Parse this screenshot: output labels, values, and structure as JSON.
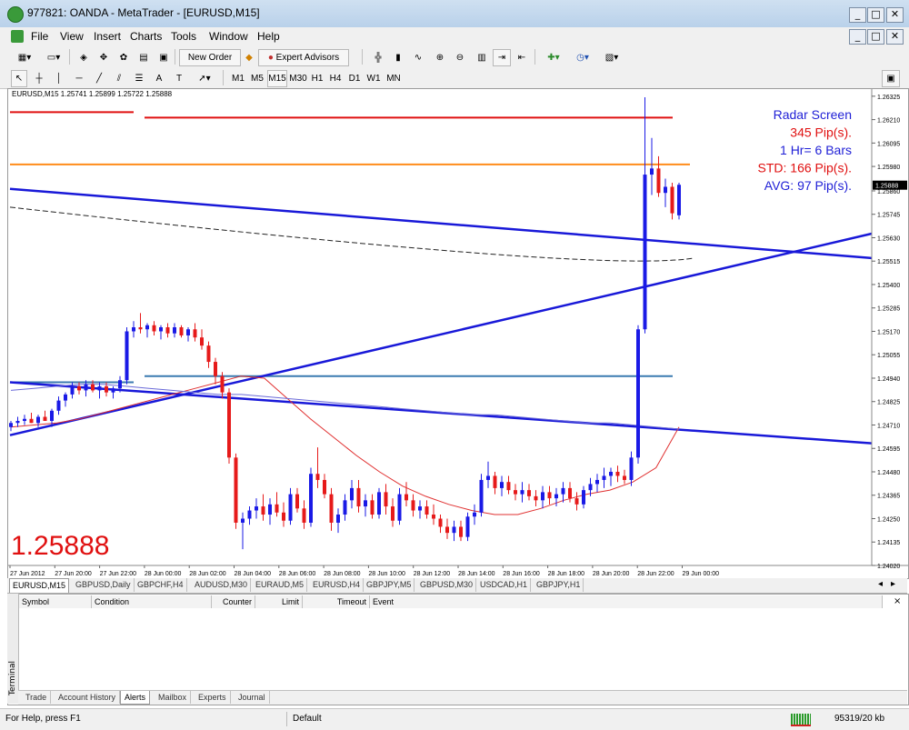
{
  "window": {
    "title": "977821: OANDA - MetaTrader - [EURUSD,M15]",
    "min_label": "_",
    "restore_label": "□",
    "close_label": "✕"
  },
  "menu": [
    "File",
    "View",
    "Insert",
    "Charts",
    "Tools",
    "Window",
    "Help"
  ],
  "toolbar": {
    "new_order": "New Order",
    "expert_advisors": "Expert Advisors"
  },
  "timeframes": [
    "M1",
    "M5",
    "M15",
    "M30",
    "H1",
    "H4",
    "D1",
    "W1",
    "MN"
  ],
  "active_timeframe": "M15",
  "chart": {
    "info": "EURUSD,M15  1.25741 1.25899 1.25722 1.25888",
    "big_price": "1.25888",
    "current_price_tag": "1.25888",
    "price_ticks": [
      "1.26325",
      "1.26210",
      "1.26095",
      "1.25980",
      "1.25860",
      "1.25745",
      "1.25630",
      "1.25515",
      "1.25400",
      "1.25285",
      "1.25170",
      "1.25055",
      "1.24940",
      "1.24825",
      "1.24710",
      "1.24595",
      "1.24480",
      "1.24365",
      "1.24250",
      "1.24135",
      "1.24020"
    ],
    "time_ticks": [
      "27 Jun 2012",
      "27 Jun 20:00",
      "27 Jun 22:00",
      "28 Jun 00:00",
      "28 Jun 02:00",
      "28 Jun 04:00",
      "28 Jun 06:00",
      "28 Jun 08:00",
      "28 Jun 10:00",
      "28 Jun 12:00",
      "28 Jun 14:00",
      "28 Jun 16:00",
      "28 Jun 18:00",
      "28 Jun 20:00",
      "28 Jun 22:00",
      "29 Jun 00:00"
    ],
    "radar": [
      {
        "text": "Radar Screen",
        "color": "#1f1fd6"
      },
      {
        "text": "345 Pip(s).",
        "color": "#e01010"
      },
      {
        "text": "1 Hr= 6 Bars",
        "color": "#1f1fd6"
      },
      {
        "text": "STD: 166 Pip(s).",
        "color": "#e01010"
      },
      {
        "text": "AVG: 97 Pip(s).",
        "color": "#1f1fd6"
      }
    ],
    "colors": {
      "bull": "#1a1ae6",
      "bear": "#e61a1a",
      "ma": "#e03030",
      "trend": "#1818d8",
      "resistance": "#e01010",
      "orange": "#ff8c1a"
    }
  },
  "chart_data": {
    "type": "candlestick",
    "symbol": "EURUSD",
    "timeframe": "M15",
    "ylim": [
      1.2402,
      1.2636
    ],
    "levels": {
      "red": 1.2622,
      "orange": 1.2599,
      "steel": 1.2495
    },
    "candles": [
      [
        1.247,
        1.2473,
        1.2468,
        1.2472
      ],
      [
        1.2472,
        1.2475,
        1.247,
        1.2473
      ],
      [
        1.2473,
        1.2476,
        1.2471,
        1.2474
      ],
      [
        1.2474,
        1.2477,
        1.2472,
        1.2472
      ],
      [
        1.2472,
        1.2476,
        1.247,
        1.2475
      ],
      [
        1.2475,
        1.2478,
        1.2473,
        1.2473
      ],
      [
        1.2473,
        1.2479,
        1.247,
        1.2478
      ],
      [
        1.2478,
        1.2485,
        1.2476,
        1.2483
      ],
      [
        1.2483,
        1.2487,
        1.248,
        1.2486
      ],
      [
        1.2486,
        1.2492,
        1.2484,
        1.249
      ],
      [
        1.249,
        1.2492,
        1.2486,
        1.2488
      ],
      [
        1.2488,
        1.2493,
        1.2485,
        1.2491
      ],
      [
        1.2491,
        1.2493,
        1.2487,
        1.2488
      ],
      [
        1.2488,
        1.2492,
        1.2484,
        1.249
      ],
      [
        1.249,
        1.2492,
        1.2485,
        1.2487
      ],
      [
        1.2487,
        1.249,
        1.2484,
        1.2489
      ],
      [
        1.2489,
        1.2495,
        1.2487,
        1.2493
      ],
      [
        1.2493,
        1.2519,
        1.2491,
        1.2517
      ],
      [
        1.2517,
        1.2522,
        1.2514,
        1.2519
      ],
      [
        1.2519,
        1.2526,
        1.2516,
        1.2518
      ],
      [
        1.2518,
        1.2521,
        1.2514,
        1.252
      ],
      [
        1.252,
        1.2522,
        1.2515,
        1.2517
      ],
      [
        1.2517,
        1.252,
        1.2513,
        1.2519
      ],
      [
        1.2519,
        1.2521,
        1.2514,
        1.2516
      ],
      [
        1.2516,
        1.2521,
        1.2514,
        1.2519
      ],
      [
        1.2519,
        1.252,
        1.2514,
        1.2515
      ],
      [
        1.2515,
        1.2519,
        1.2512,
        1.2518
      ],
      [
        1.2518,
        1.2521,
        1.2512,
        1.2514
      ],
      [
        1.2514,
        1.2518,
        1.2508,
        1.251
      ],
      [
        1.251,
        1.2512,
        1.2499,
        1.2502
      ],
      [
        1.2502,
        1.2504,
        1.2491,
        1.2495
      ],
      [
        1.2495,
        1.2497,
        1.2484,
        1.2487
      ],
      [
        1.2487,
        1.2489,
        1.2452,
        1.2455
      ],
      [
        1.2455,
        1.2457,
        1.242,
        1.2423
      ],
      [
        1.2423,
        1.2428,
        1.241,
        1.2425
      ],
      [
        1.2425,
        1.2431,
        1.2422,
        1.2429
      ],
      [
        1.2429,
        1.2435,
        1.2425,
        1.2431
      ],
      [
        1.2431,
        1.2437,
        1.2424,
        1.2427
      ],
      [
        1.2427,
        1.2435,
        1.2422,
        1.2432
      ],
      [
        1.2432,
        1.2438,
        1.2426,
        1.2428
      ],
      [
        1.2428,
        1.2433,
        1.2421,
        1.2424
      ],
      [
        1.2424,
        1.244,
        1.2422,
        1.2437
      ],
      [
        1.2437,
        1.244,
        1.2428,
        1.243
      ],
      [
        1.243,
        1.2434,
        1.242,
        1.2423
      ],
      [
        1.2423,
        1.245,
        1.2421,
        1.2447
      ],
      [
        1.2447,
        1.246,
        1.244,
        1.2444
      ],
      [
        1.2444,
        1.2447,
        1.2435,
        1.2437
      ],
      [
        1.2437,
        1.244,
        1.2419,
        1.2423
      ],
      [
        1.2423,
        1.243,
        1.2418,
        1.2427
      ],
      [
        1.2427,
        1.2437,
        1.2424,
        1.2434
      ],
      [
        1.2434,
        1.2444,
        1.243,
        1.244
      ],
      [
        1.244,
        1.2444,
        1.2428,
        1.2431
      ],
      [
        1.2431,
        1.2437,
        1.2426,
        1.2434
      ],
      [
        1.2434,
        1.2437,
        1.2425,
        1.2427
      ],
      [
        1.2427,
        1.244,
        1.2425,
        1.2438
      ],
      [
        1.2438,
        1.2442,
        1.2427,
        1.2431
      ],
      [
        1.2431,
        1.2435,
        1.2421,
        1.2424
      ],
      [
        1.2424,
        1.244,
        1.2422,
        1.2437
      ],
      [
        1.2437,
        1.2443,
        1.2431,
        1.2434
      ],
      [
        1.2434,
        1.2437,
        1.2426,
        1.2429
      ],
      [
        1.2429,
        1.2434,
        1.2425,
        1.2431
      ],
      [
        1.2431,
        1.2434,
        1.2425,
        1.2427
      ],
      [
        1.2427,
        1.2432,
        1.2422,
        1.2425
      ],
      [
        1.2425,
        1.2427,
        1.2418,
        1.2421
      ],
      [
        1.2421,
        1.2425,
        1.2415,
        1.2418
      ],
      [
        1.2418,
        1.2424,
        1.2414,
        1.2421
      ],
      [
        1.2421,
        1.2424,
        1.2414,
        1.2416
      ],
      [
        1.2416,
        1.2428,
        1.2414,
        1.2426
      ],
      [
        1.2426,
        1.2432,
        1.2422,
        1.2428
      ],
      [
        1.2428,
        1.2447,
        1.2426,
        1.2444
      ],
      [
        1.2444,
        1.2453,
        1.244,
        1.2446
      ],
      [
        1.2446,
        1.2448,
        1.2437,
        1.244
      ],
      [
        1.244,
        1.2446,
        1.2436,
        1.2443
      ],
      [
        1.2443,
        1.2446,
        1.2437,
        1.2439
      ],
      [
        1.2439,
        1.2442,
        1.2434,
        1.2437
      ],
      [
        1.2437,
        1.2443,
        1.2433,
        1.2439
      ],
      [
        1.2439,
        1.2442,
        1.2434,
        1.2436
      ],
      [
        1.2436,
        1.2439,
        1.2431,
        1.2434
      ],
      [
        1.2434,
        1.2441,
        1.243,
        1.2438
      ],
      [
        1.2438,
        1.2441,
        1.2432,
        1.2435
      ],
      [
        1.2435,
        1.244,
        1.2431,
        1.2437
      ],
      [
        1.2437,
        1.2443,
        1.2433,
        1.244
      ],
      [
        1.244,
        1.2443,
        1.2433,
        1.2435
      ],
      [
        1.2435,
        1.2438,
        1.2429,
        1.2432
      ],
      [
        1.2432,
        1.2441,
        1.243,
        1.2439
      ],
      [
        1.2439,
        1.2445,
        1.2436,
        1.2442
      ],
      [
        1.2442,
        1.2447,
        1.2438,
        1.2444
      ],
      [
        1.2444,
        1.245,
        1.244,
        1.2446
      ],
      [
        1.2446,
        1.245,
        1.2441,
        1.2448
      ],
      [
        1.2448,
        1.2451,
        1.2443,
        1.2446
      ],
      [
        1.2446,
        1.2449,
        1.2442,
        1.2444
      ],
      [
        1.2444,
        1.2458,
        1.2441,
        1.2455
      ],
      [
        1.2455,
        1.252,
        1.2452,
        1.2518
      ],
      [
        1.2518,
        1.2632,
        1.2516,
        1.2594
      ],
      [
        1.2594,
        1.2612,
        1.2584,
        1.2597
      ],
      [
        1.2597,
        1.2603,
        1.2583,
        1.2585
      ],
      [
        1.2585,
        1.2592,
        1.2578,
        1.2588
      ],
      [
        1.2588,
        1.259,
        1.2572,
        1.2575
      ],
      [
        1.2574,
        1.259,
        1.2572,
        1.2589
      ]
    ],
    "ma_red": [
      1.247,
      1.2471,
      1.2472,
      1.2474,
      1.2477,
      1.248,
      1.2483,
      1.2486,
      1.2489,
      1.2492,
      1.2495,
      1.2494,
      1.2484,
      1.2474,
      1.2465,
      1.2456,
      1.2448,
      1.2441,
      1.2436,
      1.2432,
      1.2429,
      1.2427,
      1.2427,
      1.243,
      1.2434,
      1.2437,
      1.2439,
      1.2443,
      1.245,
      1.247
    ],
    "ma_blue": [
      1.2488,
      1.2489,
      1.249,
      1.2491,
      1.2491,
      1.249,
      1.2489,
      1.2488,
      1.2487,
      1.2486,
      1.2486,
      1.2485,
      1.2484,
      1.2483,
      1.2482,
      1.2481,
      1.248,
      1.2479,
      1.2478,
      1.2477,
      1.2476,
      1.2476,
      1.2475,
      1.2474,
      1.2473,
      1.2472,
      1.2472,
      1.2471,
      1.247,
      1.2469
    ]
  },
  "symbol_tabs": [
    "EURUSD,M15",
    "GBPUSD,Daily",
    "GBPCHF,H4",
    "AUDUSD,M30",
    "EURAUD,M5",
    "EURUSD,H4",
    "GBPJPY,M5",
    "GBPUSD,M30",
    "USDCAD,H1",
    "GBPJPY,H1"
  ],
  "terminal": {
    "side_label": "Terminal",
    "columns": [
      "Symbol",
      "Condition",
      "Counter",
      "Limit",
      "Timeout",
      "Event"
    ],
    "tabs": [
      "Trade",
      "Account History",
      "Alerts",
      "Mailbox",
      "Experts",
      "Journal"
    ],
    "active_tab": "Alerts"
  },
  "status": {
    "help": "For Help, press F1",
    "profile": "Default",
    "traffic": "95319/20 kb"
  }
}
